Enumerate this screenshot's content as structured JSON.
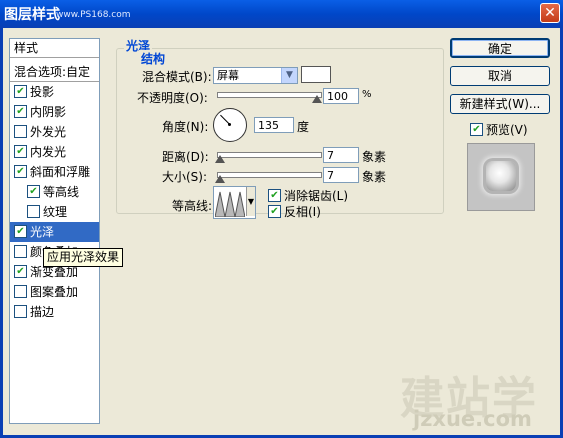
{
  "window": {
    "title": "图层样式",
    "site_watermark": "www.PS168.com",
    "close_glyph": "✕"
  },
  "style_list": {
    "header": "样式",
    "blend_options": "混合选项:自定",
    "items": [
      {
        "label": "投影",
        "checked": true,
        "selected": false,
        "indent": 0
      },
      {
        "label": "内阴影",
        "checked": true,
        "selected": false,
        "indent": 0
      },
      {
        "label": "外发光",
        "checked": false,
        "selected": false,
        "indent": 0
      },
      {
        "label": "内发光",
        "checked": true,
        "selected": false,
        "indent": 0
      },
      {
        "label": "斜面和浮雕",
        "checked": true,
        "selected": false,
        "indent": 0
      },
      {
        "label": "等高线",
        "checked": true,
        "selected": false,
        "indent": 1
      },
      {
        "label": "纹理",
        "checked": false,
        "selected": false,
        "indent": 1
      },
      {
        "label": "光泽",
        "checked": true,
        "selected": true,
        "indent": 0
      },
      {
        "label": "颜色叠加",
        "checked": false,
        "selected": false,
        "indent": 0
      },
      {
        "label": "渐变叠加",
        "checked": true,
        "selected": false,
        "indent": 0
      },
      {
        "label": "图案叠加",
        "checked": false,
        "selected": false,
        "indent": 0
      },
      {
        "label": "描边",
        "checked": false,
        "selected": false,
        "indent": 0
      }
    ],
    "tooltip": "应用光泽效果"
  },
  "satin": {
    "group_title": "光泽",
    "structure_title": "结构",
    "blend_mode_label": "混合模式(B):",
    "blend_mode_value": "屏幕",
    "color_swatch": "#ffffff",
    "opacity_label": "不透明度(O):",
    "opacity_value": "100",
    "opacity_unit": "%",
    "opacity_fraction": 1.0,
    "angle_label": "角度(N):",
    "angle_value": "135",
    "angle_unit": "度",
    "distance_label": "距离(D):",
    "distance_value": "7",
    "distance_unit": "象素",
    "distance_fraction": 0.03,
    "size_label": "大小(S):",
    "size_value": "7",
    "size_unit": "象素",
    "size_fraction": 0.03,
    "contour_label": "等高线:",
    "anti_alias_label": "消除锯齿(L)",
    "anti_alias_checked": true,
    "invert_label": "反相(I)",
    "invert_checked": true
  },
  "buttons": {
    "ok": "确定",
    "cancel": "取消",
    "new_style": "新建样式(W)..."
  },
  "preview": {
    "label": "预览(V)",
    "checked": true
  },
  "watermark": {
    "text": "建站学",
    "url": "jzxue.com"
  },
  "colors": {
    "title_bar": "#0047c9",
    "selected_item": "#316ac5",
    "section_title": "#0046d5",
    "checkmark": "#21a121"
  }
}
